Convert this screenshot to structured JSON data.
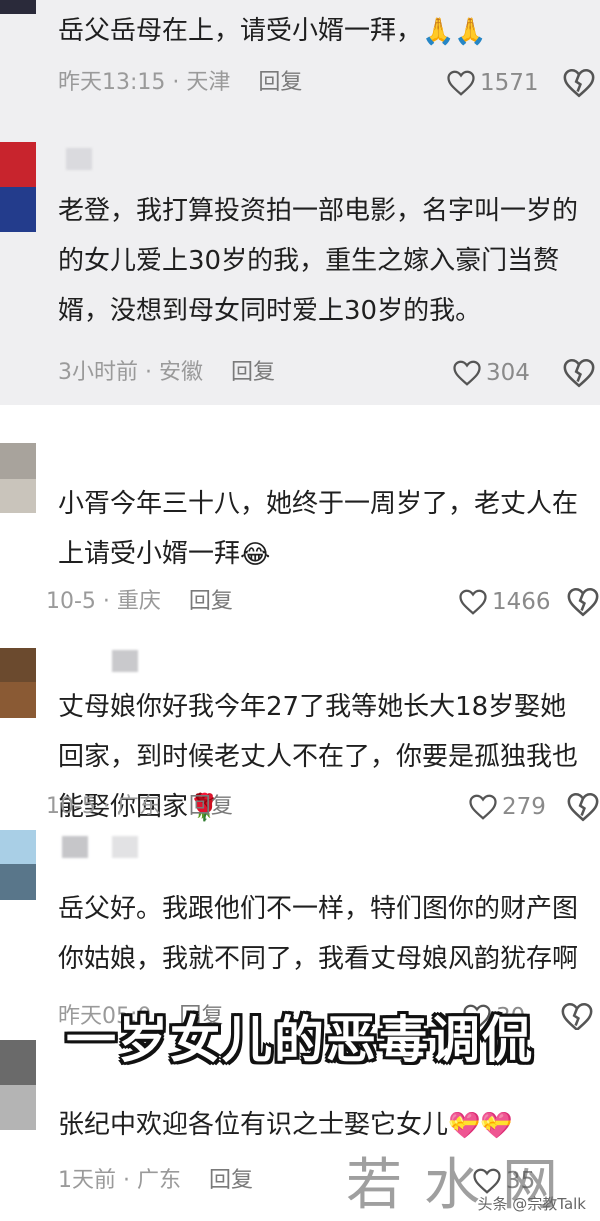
{
  "comments": [
    {
      "text": "岳父岳母在上，请受小婿一拜，",
      "emoji": "🙏🙏",
      "time_location": "昨天13:15 · 天津",
      "reply": "回复",
      "likes": "1571"
    },
    {
      "text": "老登，我打算投资拍一部电影，名字叫一岁的的女儿爱上30岁的我，重生之嫁入豪门当赘婿，没想到母女同时爱上30岁的我。",
      "time_location": "3小时前 · 安徽",
      "reply": "回复",
      "likes": "304"
    },
    {
      "text": "小胥今年三十八，她终于一周岁了，老丈人在上请受小婿一拜",
      "emoji": "😂",
      "time_location": "10-5 · 重庆",
      "reply": "回复",
      "likes": "1466"
    },
    {
      "text": "丈母娘你好我今年27了我等她长大18岁娶她回家，到时候老丈人不在了，你要是孤独我也能娶你回家",
      "emoji": "🌹",
      "time_location": "10-5 · 广东",
      "reply": "回复",
      "likes": "279"
    },
    {
      "text": "岳父好。我跟他们不一样，特们图你的财产图你姑娘，我就不同了，我看丈母娘风韵犹存啊",
      "time_location": "昨天05:0",
      "reply": "回复",
      "likes": "30"
    },
    {
      "text": "张纪中欢迎各位有识之士娶它女儿",
      "emoji": "💝💝",
      "time_location": "1天前 · 广东",
      "reply": "回复",
      "likes": "35"
    }
  ],
  "overlay": {
    "caption": "一岁女儿的恶毒调侃",
    "watermark": "若水网",
    "source": "头条 @宗教Talk"
  },
  "icons": {
    "like": "heart-outline-icon",
    "dislike": "broken-heart-icon"
  },
  "colors": {
    "shade_bg": "#efeff1",
    "white_bg": "#ffffff",
    "text": "#1f1f1f",
    "meta": "#9a9a9a"
  }
}
